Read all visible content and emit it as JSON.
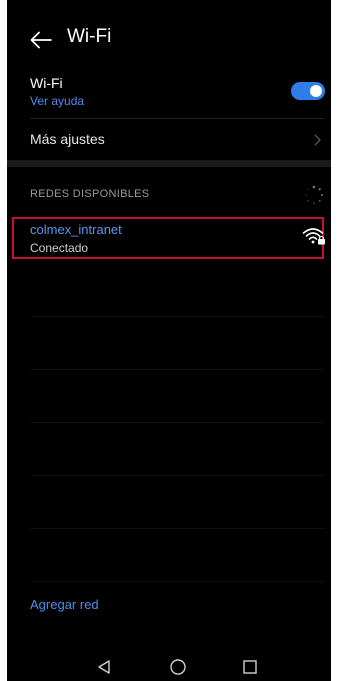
{
  "header": {
    "title": "Wi-Fi",
    "back_icon": "arrow-left-icon"
  },
  "wifi_toggle": {
    "label": "Wi-Fi",
    "help_link": "Ver ayuda",
    "enabled": true,
    "accent": "#2f7de8"
  },
  "more_settings": {
    "label": "Más ajustes",
    "icon": "chevron-right-icon"
  },
  "available_networks": {
    "section_title": "REDES DISPONIBLES",
    "loading_icon": "spinner-icon",
    "items": [
      {
        "name": "colmex_intranet",
        "status": "Conectado",
        "icon": "wifi-lock-icon",
        "highlight_color": "#c8102e"
      }
    ]
  },
  "add_network": {
    "label": "Agregar red"
  },
  "navigation_bar": {
    "back": "triangle-back-icon",
    "home": "circle-home-icon",
    "recents": "square-recents-icon"
  }
}
